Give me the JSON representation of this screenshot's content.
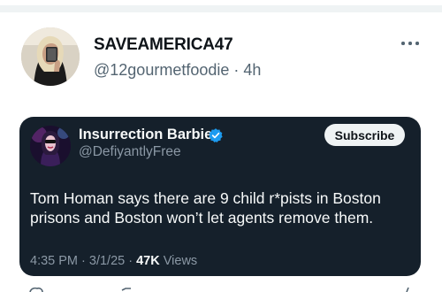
{
  "post": {
    "display_name": "SAVEAMERICA47",
    "handle": "@12gourmetfoodie",
    "separator": " · ",
    "time": "4h",
    "more_icon": "more-horizontal-icon"
  },
  "quote": {
    "display_name": "Insurrection Barbie",
    "verified_icon": "verified-badge-icon",
    "handle": "@DefiyantlyFree",
    "subscribe_label": "Subscribe",
    "text_lines": [
      "Tom Homan says there are 9 child r*pists in Boston",
      "prisons and Boston won’t let agents remove them."
    ],
    "time": "4:35 PM",
    "date": "3/1/25",
    "dot": " · ",
    "views_count": "47K",
    "views_label": " Views"
  },
  "colors": {
    "card_background": "#15202b",
    "verified_blue": "#1d9bf0",
    "secondary_text": "#536471",
    "subscribe_bg": "#eff3f4"
  }
}
